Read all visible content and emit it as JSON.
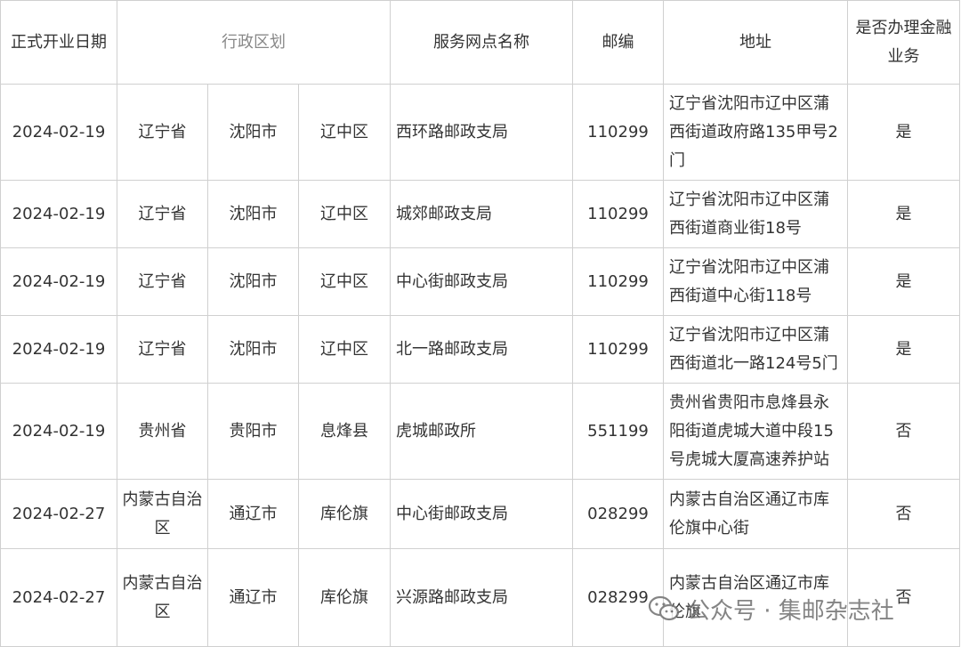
{
  "header": {
    "open_date": "正式开业日期",
    "admin_region": "行政区划",
    "outlet_name": "服务网点名称",
    "postcode": "邮编",
    "address": "地址",
    "finance": "是否办理金融业务"
  },
  "rows": [
    {
      "date": "2024-02-19",
      "province": "辽宁省",
      "city": "沈阳市",
      "district": "辽中区",
      "name": "西环路邮政支局",
      "postcode": "110299",
      "address": "辽宁省沈阳市辽中区蒲西街道政府路135甲号2门",
      "finance": "是"
    },
    {
      "date": "2024-02-19",
      "province": "辽宁省",
      "city": "沈阳市",
      "district": "辽中区",
      "name": "城郊邮政支局",
      "postcode": "110299",
      "address": "辽宁省沈阳市辽中区蒲西街道商业街18号",
      "finance": "是"
    },
    {
      "date": "2024-02-19",
      "province": "辽宁省",
      "city": "沈阳市",
      "district": "辽中区",
      "name": "中心街邮政支局",
      "postcode": "110299",
      "address": "辽宁省沈阳市辽中区浦西街道中心街118号",
      "finance": "是"
    },
    {
      "date": "2024-02-19",
      "province": "辽宁省",
      "city": "沈阳市",
      "district": "辽中区",
      "name": "北一路邮政支局",
      "postcode": "110299",
      "address": "辽宁省沈阳市辽中区蒲西街道北一路124号5门",
      "finance": "是"
    },
    {
      "date": "2024-02-19",
      "province": "贵州省",
      "city": "贵阳市",
      "district": "息烽县",
      "name": "虎城邮政所",
      "postcode": "551199",
      "address": "贵州省贵阳市息烽县永阳街道虎城大道中段15号虎城大厦高速养护站",
      "finance": "否"
    },
    {
      "date": "2024-02-27",
      "province": "内蒙古自治区",
      "city": "通辽市",
      "district": "库伦旗",
      "name": "中心街邮政支局",
      "postcode": "028299",
      "address": "内蒙古自治区通辽市库伦旗中心街",
      "finance": "否"
    },
    {
      "date": "2024-02-27",
      "province": "内蒙古自治区",
      "city": "通辽市",
      "district": "库伦旗",
      "name": "兴源路邮政支局",
      "postcode": "028299",
      "address": "内蒙古自治区通辽市库伦旗",
      "finance": "否"
    }
  ],
  "watermark": {
    "text": "公众号 · 集邮杂志社",
    "icon": "wechat-icon"
  }
}
